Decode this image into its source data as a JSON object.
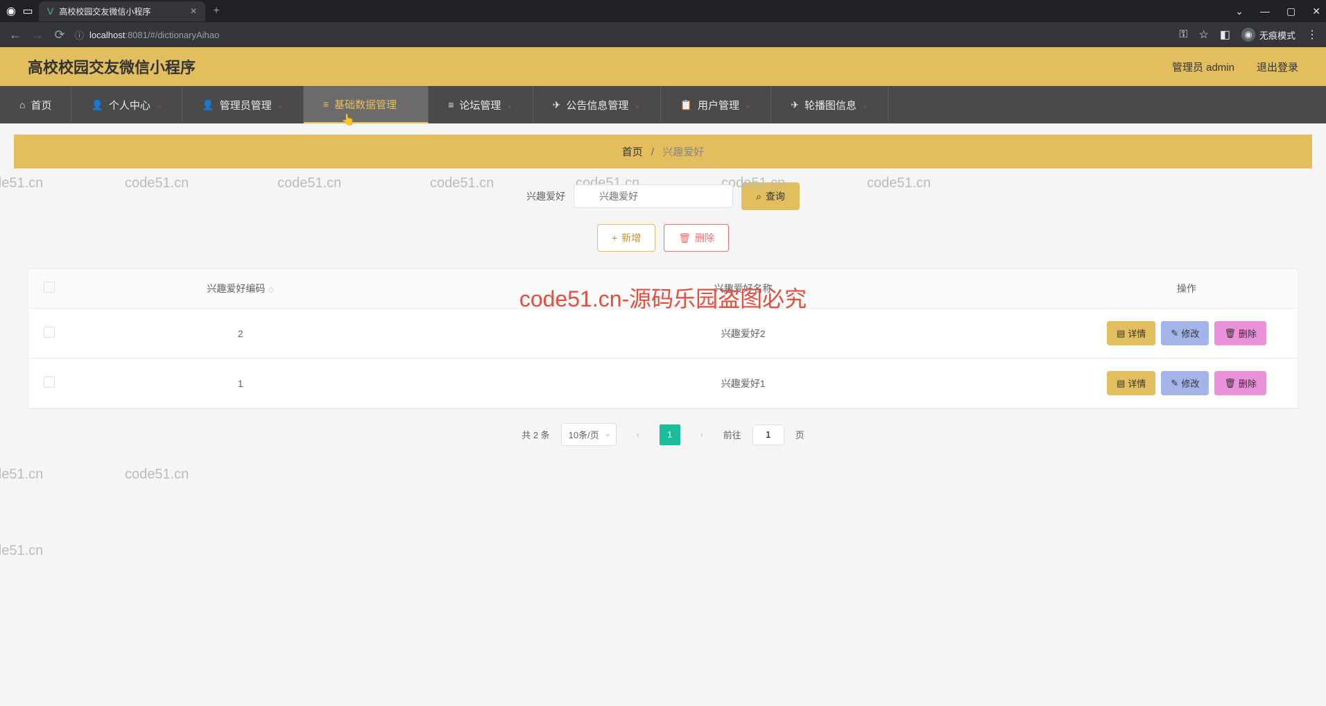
{
  "browser": {
    "tab_title": "高校校园交友微信小程序",
    "url_prefix": "localhost",
    "url_port": ":8081",
    "url_path": "/#/dictionaryAihao",
    "incognito_label": "无痕模式"
  },
  "header": {
    "app_title": "高校校园交友微信小程序",
    "user_label": "管理员 admin",
    "logout_label": "退出登录"
  },
  "menu": {
    "items": [
      {
        "label": "首页",
        "icon": "⌂"
      },
      {
        "label": "个人中心",
        "icon": "👤",
        "chevron": true
      },
      {
        "label": "管理员管理",
        "icon": "👤",
        "chevron": true
      },
      {
        "label": "基础数据管理",
        "icon": "≡",
        "chevron": true,
        "active": true
      },
      {
        "label": "论坛管理",
        "icon": "≡",
        "chevron": true
      },
      {
        "label": "公告信息管理",
        "icon": "✈",
        "chevron": true
      },
      {
        "label": "用户管理",
        "icon": "📋",
        "chevron": true
      },
      {
        "label": "轮播图信息",
        "icon": "✈",
        "chevron": true
      }
    ]
  },
  "breadcrumb": {
    "home": "首页",
    "sep": "/",
    "current": "兴趣爱好"
  },
  "search": {
    "label": "兴趣爱好",
    "placeholder": "兴趣爱好",
    "query_btn": "查询"
  },
  "actions": {
    "add": "新增",
    "delete": "删除"
  },
  "table": {
    "columns": {
      "code": "兴趣爱好编码",
      "name": "兴趣爱好名称",
      "ops": "操作"
    },
    "rows": [
      {
        "code": "2",
        "name": "兴趣爱好2"
      },
      {
        "code": "1",
        "name": "兴趣爱好1"
      }
    ],
    "btn_detail": "详情",
    "btn_edit": "修改",
    "btn_delete": "删除"
  },
  "pagination": {
    "total_text": "共 2 条",
    "per_page": "10条/页",
    "current": "1",
    "goto_prefix": "前往",
    "goto_value": "1",
    "goto_suffix": "页"
  },
  "overlay": "code51.cn-源码乐园盗图必究",
  "watermark": "code51.cn"
}
